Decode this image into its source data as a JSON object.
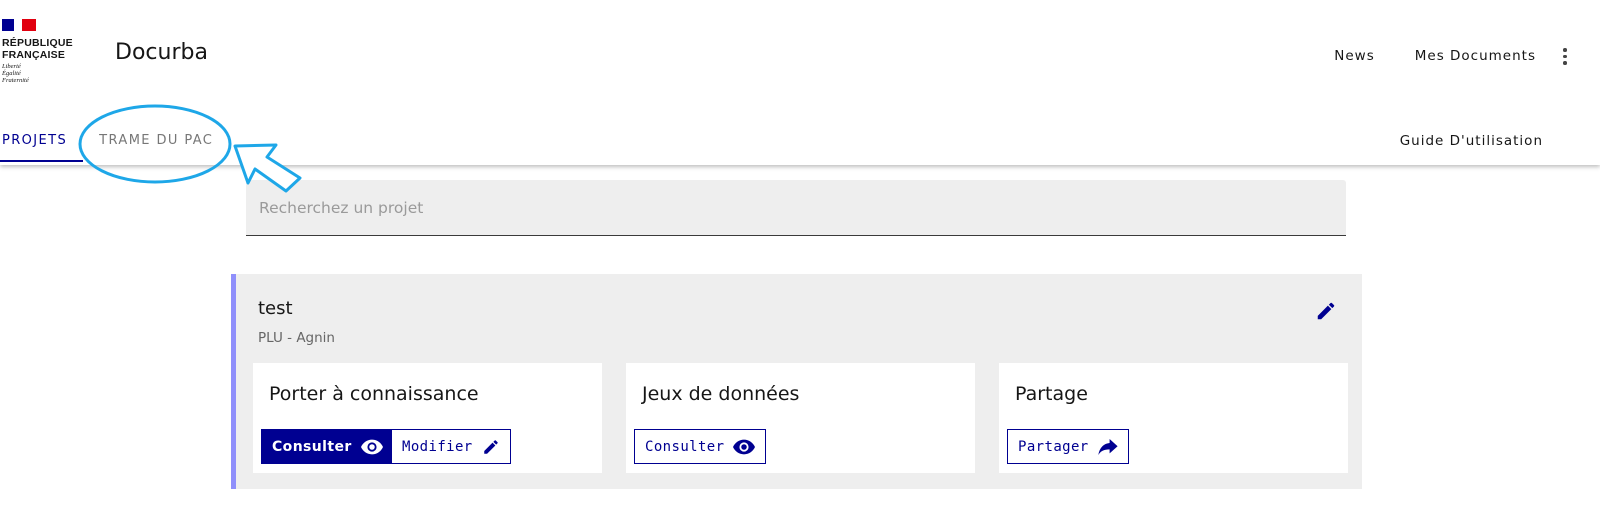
{
  "brand": {
    "rf_title_line1": "RÉPUBLIQUE",
    "rf_title_line2": "FRANÇAISE",
    "motto_line1": "Liberté",
    "motto_line2": "Égalité",
    "motto_line3": "Fraternité",
    "app_title": "Docurba"
  },
  "top_nav": {
    "news_label": "News",
    "documents_label": "Mes Documents",
    "more_icon": "more-vertical-icon"
  },
  "tabs": [
    {
      "label": "PROJETS",
      "active": true
    },
    {
      "label": "TRAME DU PAC",
      "active": false
    }
  ],
  "guide_label": "Guide D'utilisation",
  "search": {
    "placeholder": "Recherchez un projet",
    "value": ""
  },
  "project": {
    "name": "test",
    "subtitle": "PLU - Agnin",
    "edit_icon": "pencil-icon",
    "cards": [
      {
        "title": "Porter à connaissance",
        "buttons": [
          {
            "label": "Consulter",
            "icon": "eye-icon",
            "style": "primary"
          },
          {
            "label": "Modifier",
            "icon": "pencil-icon",
            "style": "secondary"
          }
        ]
      },
      {
        "title": "Jeux de données",
        "buttons": [
          {
            "label": "Consulter",
            "icon": "eye-icon",
            "style": "secondary"
          }
        ]
      },
      {
        "title": "Partage",
        "buttons": [
          {
            "label": "Partager",
            "icon": "share-arrow-icon",
            "style": "secondary"
          }
        ]
      }
    ]
  },
  "colors": {
    "primary": "#000091",
    "accent_border": "#8f8ffb",
    "annotation": "#1ea7e8",
    "card_bg": "#eeeeee"
  }
}
